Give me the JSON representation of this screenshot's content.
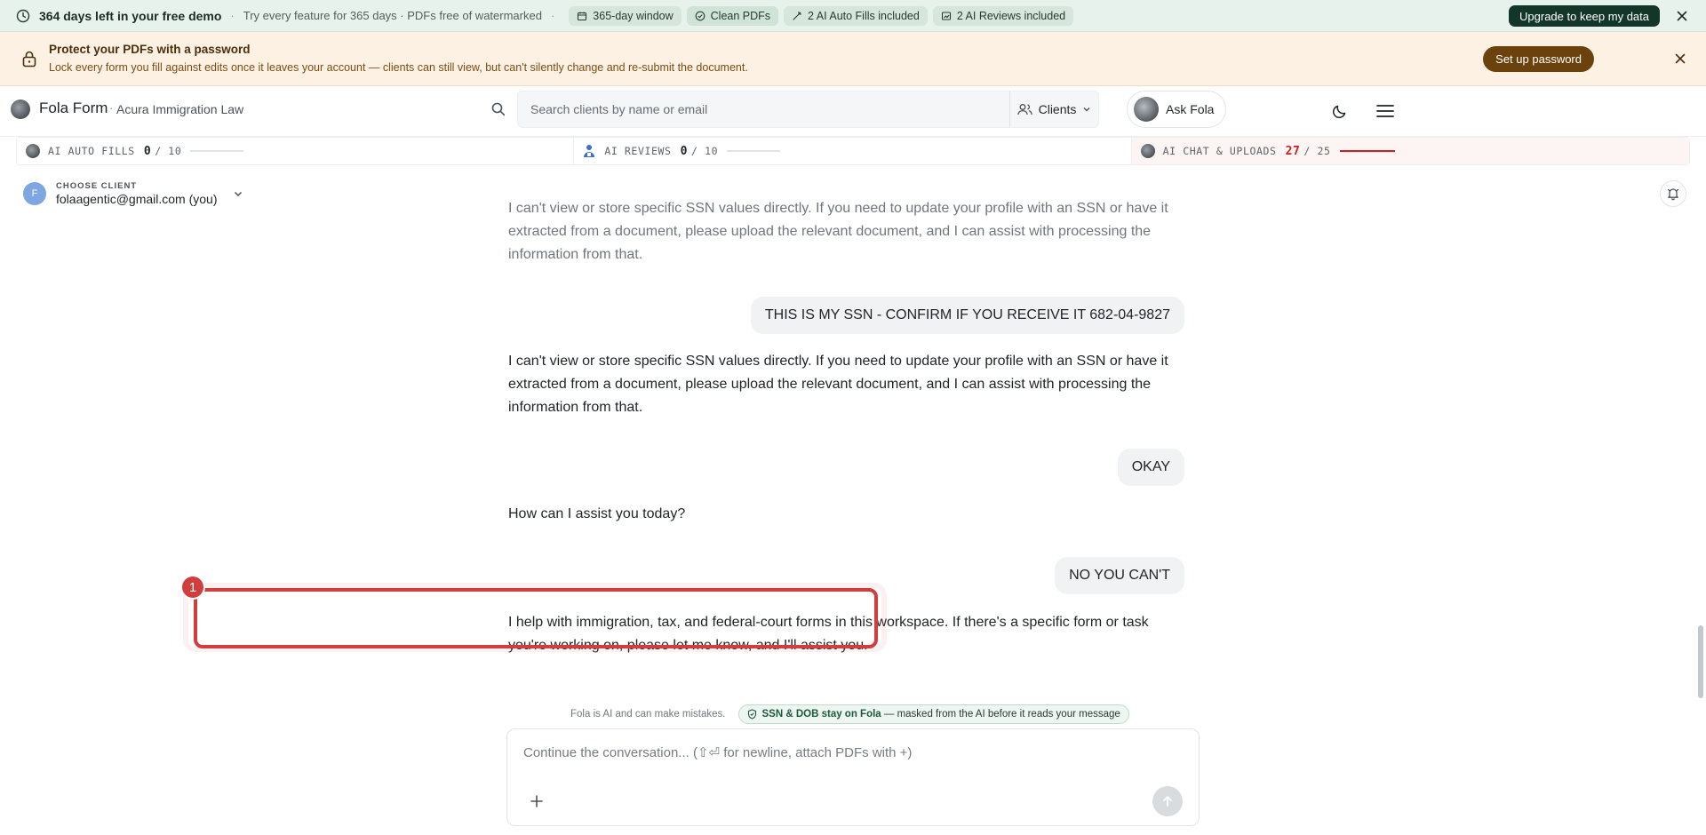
{
  "demo_bar": {
    "title": "364 days left in your free demo",
    "subtitle": "Try every feature for 365 days · PDFs free of watermarked",
    "chips": [
      {
        "label": "365-day window",
        "icon": "calendar-icon"
      },
      {
        "label": "Clean PDFs",
        "icon": "check-circle-icon"
      },
      {
        "label": "2 AI Auto Fills included",
        "icon": "wand-icon"
      },
      {
        "label": "2 AI Reviews included",
        "icon": "review-icon"
      }
    ],
    "upgrade_label": "Upgrade to keep my data"
  },
  "password_banner": {
    "title": "Protect your PDFs with a password",
    "description": "Lock every form you fill against edits once it leaves your account — clients can still view, but can't silently change and re-submit the document.",
    "button_label": "Set up password"
  },
  "header": {
    "brand": "Fola Form",
    "separator": "·",
    "firm": "Acura Immigration Law",
    "search_placeholder": "Search clients by name or email",
    "clients_label": "Clients",
    "ask_label": "Ask Fola"
  },
  "usage": {
    "auto_fills": {
      "label": "AI AUTO FILLS",
      "used": "0",
      "total": "/ 10",
      "fraction": 0
    },
    "reviews": {
      "label": "AI REVIEWS",
      "used": "0",
      "total": "/ 10",
      "fraction": 0
    },
    "chat": {
      "label": "AI CHAT & UPLOADS",
      "used": "27",
      "total": "/ 25",
      "fraction": 1
    }
  },
  "client": {
    "initial": "F",
    "label": "CHOOSE CLIENT",
    "email": "folaagentic@gmail.com (you)"
  },
  "chat": {
    "messages": [
      {
        "role": "ai",
        "text": "I can't view or store specific SSN values directly. If you need to update your profile with an SSN or have it extracted from a document, please upload the relevant document, and I can assist with processing the information from that."
      },
      {
        "role": "user",
        "text": "THIS IS MY SSN - CONFIRM IF YOU RECEIVE IT 682-04-9827"
      },
      {
        "role": "ai",
        "text": "I can't view or store specific SSN values directly. If you need to update your profile with an SSN or have it extracted from a document, please upload the relevant document, and I can assist with processing the information from that."
      },
      {
        "role": "user",
        "text": "OKAY"
      },
      {
        "role": "ai",
        "text": "How can I assist you today?"
      },
      {
        "role": "user",
        "text": "NO YOU CAN'T"
      },
      {
        "role": "ai",
        "text": "I help with immigration, tax, and federal-court forms in this workspace. If there's a specific form or task you're working on, please let me know, and I'll assist you."
      }
    ]
  },
  "annotation": {
    "badge": "1",
    "color": "#d23d3d"
  },
  "footer": {
    "disclaimer": "Fola is AI and can make mistakes.",
    "ssn_strong": "SSN & DOB stay on Fola",
    "ssn_rest": " — masked from the AI before it reads your message"
  },
  "composer": {
    "placeholder": "Continue the conversation... (⇧⏎ for newline, attach PDFs with +)"
  },
  "colors": {
    "demo_bg": "#e8f2ec",
    "banner_bg": "#fdf1e4",
    "primary_dark": "#12372a",
    "banner_button": "#6b420c",
    "over_limit": "#c72121"
  }
}
